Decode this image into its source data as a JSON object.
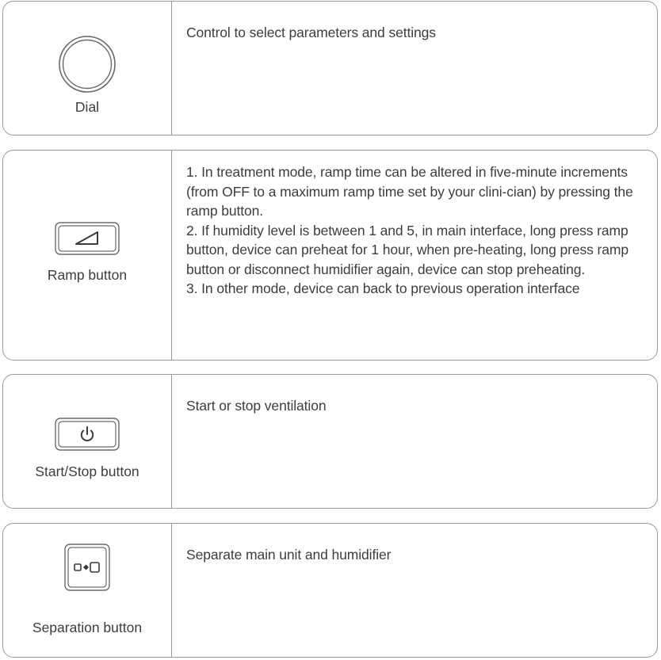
{
  "controls": [
    {
      "label": "Dial",
      "icon": "dial-icon",
      "description": [
        "Control to select parameters and settings"
      ]
    },
    {
      "label": "Ramp button",
      "icon": "ramp-icon",
      "description": [
        "1. In treatment mode, ramp time can be altered in five-minute increments (from OFF to a maximum ramp time set by your clini-cian) by pressing the ramp button.",
        "2. If humidity level is between 1 and 5, in main interface, long press ramp button, device can preheat for 1 hour, when pre-heating, long press ramp button or disconnect humidifier again, device can stop preheating.",
        "3. In other mode, device can back to previous operation interface"
      ]
    },
    {
      "label": "Start/Stop button",
      "icon": "power-icon",
      "description": [
        "Start or stop ventilation"
      ]
    },
    {
      "label": "Separation button",
      "icon": "separation-icon",
      "description": [
        "Separate main unit and humidifier"
      ]
    }
  ],
  "colors": {
    "border": "#9a9a9a",
    "text": "#3d3d3d"
  }
}
